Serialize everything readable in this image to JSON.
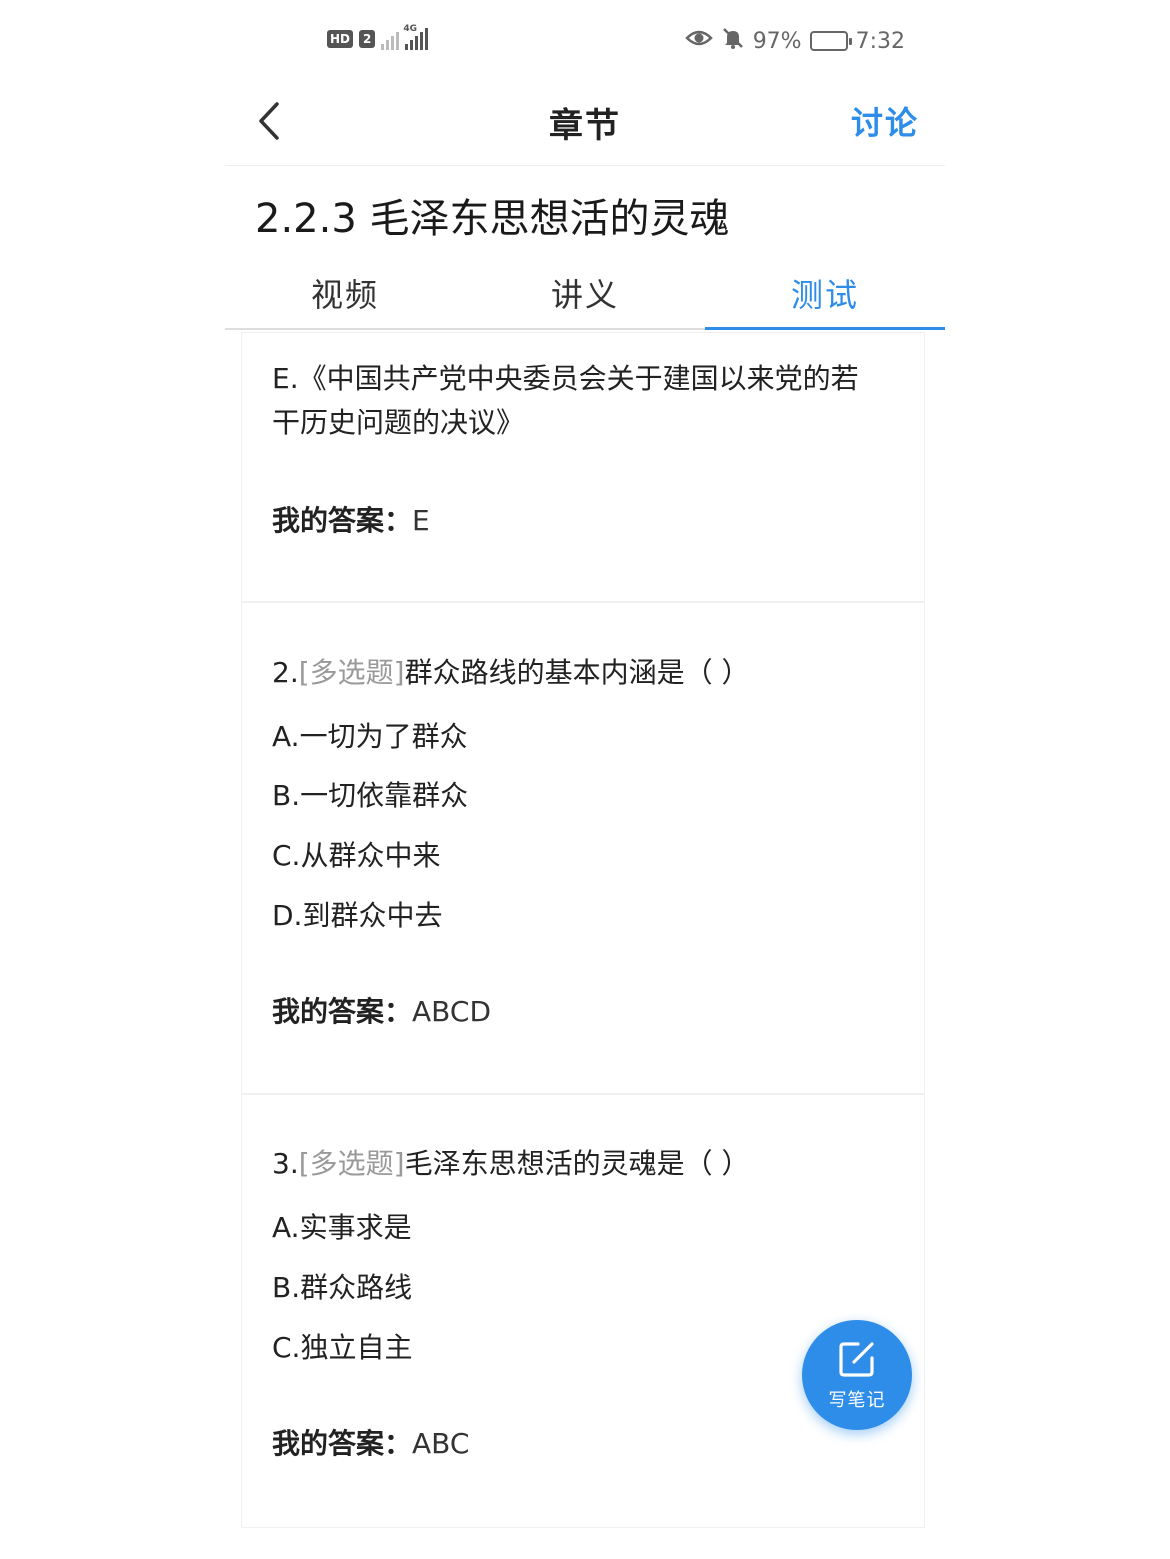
{
  "status_bar": {
    "hd": "HD",
    "sim": "2",
    "network": "4G",
    "battery": "97%",
    "battery_level": 0.97,
    "time": "7:32"
  },
  "nav": {
    "title": "章节",
    "action": "讨论"
  },
  "section_title": "2.2.3 毛泽东思想活的灵魂",
  "tabs": [
    {
      "label": "视频",
      "active": false
    },
    {
      "label": "讲义",
      "active": false
    },
    {
      "label": "测试",
      "active": true
    }
  ],
  "answer_label": "我的答案：",
  "questions": [
    {
      "options": [
        "E.《中国共产党中央委员会关于建国以来党的若",
        "干历史问题的决议》"
      ],
      "answer": "E"
    },
    {
      "number": "2.",
      "type": "[多选题]",
      "stem": "群众路线的基本内涵是（   ）",
      "options": [
        "A.一切为了群众",
        "B.一切依靠群众",
        "C.从群众中来",
        "D.到群众中去"
      ],
      "answer": "ABCD"
    },
    {
      "number": "3.",
      "type": "[多选题]",
      "stem": "毛泽东思想活的灵魂是（ ）",
      "options": [
        "A.实事求是",
        "B.群众路线",
        "C.独立自主"
      ],
      "answer": "ABC"
    }
  ],
  "fab": {
    "label": "写笔记",
    "icon": "edit-note-icon",
    "color": "#2d8de8"
  }
}
